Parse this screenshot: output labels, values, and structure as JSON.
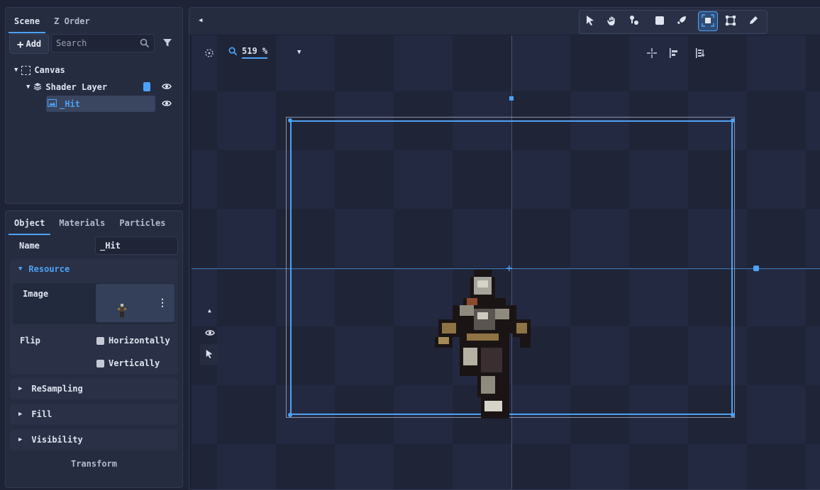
{
  "scene_panel": {
    "tabs": [
      {
        "label": "Scene"
      },
      {
        "label": "Z Order"
      }
    ],
    "add_label": "Add",
    "search_placeholder": "Search",
    "tree": [
      {
        "label": "Canvas"
      },
      {
        "label": "Shader Layer"
      },
      {
        "label": "_Hit"
      }
    ]
  },
  "object_panel": {
    "tabs": [
      {
        "label": "Object"
      },
      {
        "label": "Materials"
      },
      {
        "label": "Particles"
      }
    ],
    "name_label": "Name",
    "name_value": "_Hit",
    "resource_label": "Resource",
    "image_label": "Image",
    "flip_label": "Flip",
    "flip_horizontal": "Horizontally",
    "flip_vertical": "Vertically",
    "sections": [
      {
        "label": "ReSampling"
      },
      {
        "label": "Fill"
      },
      {
        "label": "Visibility"
      }
    ],
    "transform_label": "Transform"
  },
  "viewport": {
    "zoom": "519 %"
  },
  "colors": {
    "accent": "#4ea2f5",
    "panel": "#252c40",
    "background": "#1e2436"
  },
  "icons": [
    "collapse-left-icon",
    "pointer-icon",
    "hand-icon",
    "node-add-icon",
    "rect-icon",
    "rocket-icon",
    "frame-select-icon",
    "bounds-icon",
    "pencil-icon",
    "search-icon",
    "filter-icon",
    "eye-icon",
    "layers-icon",
    "image-icon",
    "crosshair-icon",
    "align-left-icon",
    "sort-icon",
    "chevron-up-icon",
    "kebab-icon"
  ]
}
